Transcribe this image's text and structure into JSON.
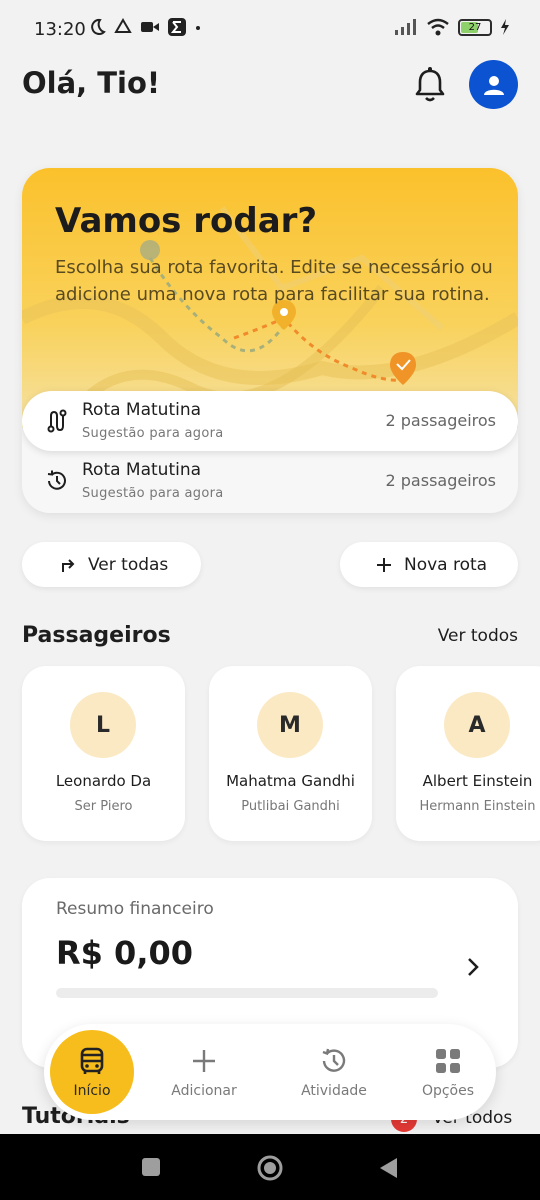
{
  "status": {
    "time": "13:20",
    "battery": "27"
  },
  "header": {
    "greeting": "Olá, Tio!"
  },
  "hero": {
    "title": "Vamos rodar?",
    "description": "Escolha sua rota favorita. Edite se necessário ou adicione uma nova rota para facilitar sua rotina."
  },
  "routes": [
    {
      "name": "Rota Matutina",
      "sub": "Sugestão para agora",
      "count": "2 passageiros"
    },
    {
      "name": "Rota Matutina",
      "sub": "Sugestão para agora",
      "count": "2 passageiros"
    }
  ],
  "actions": {
    "view_all": "Ver todas",
    "new_route": "Nova rota"
  },
  "passengers": {
    "title": "Passageiros",
    "view_all": "Ver todos",
    "items": [
      {
        "initial": "L",
        "name": "Leonardo Da",
        "sub": "Ser Piero"
      },
      {
        "initial": "M",
        "name": "Mahatma Gandhi",
        "sub": "Putlibai Gandhi"
      },
      {
        "initial": "A",
        "name": "Albert Einstein",
        "sub": "Hermann Einstein"
      }
    ]
  },
  "finance": {
    "label": "Resumo financeiro",
    "value": "R$ 0,00",
    "progress": 0
  },
  "tutorials": {
    "title": "Tutoriais",
    "badge": "2",
    "view_all": "Ver todos"
  },
  "nav": {
    "home": "Início",
    "add": "Adicionar",
    "activity": "Atividade",
    "options": "Opções"
  },
  "colors": {
    "primary_yellow": "#f6bd1c",
    "avatar_blue": "#0b53d1",
    "badge_red": "#e53935"
  },
  "icons": [
    "moon-icon",
    "drive-icon",
    "video-icon",
    "sigma-icon",
    "signal-icon",
    "wifi-icon",
    "bell-icon",
    "user-icon",
    "route-icon",
    "history-icon",
    "arrow-turn-icon",
    "plus-icon",
    "chevron-right-icon",
    "bus-icon",
    "options-grid-icon"
  ]
}
